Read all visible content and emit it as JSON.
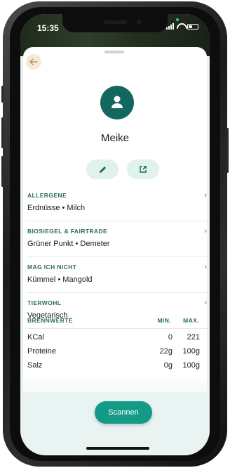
{
  "status_bar": {
    "time": "15:35"
  },
  "profile": {
    "name": "Meike"
  },
  "sections": [
    {
      "title": "ALLERGENE",
      "value": "Erdnüsse • Milch"
    },
    {
      "title": "BIOSIEGEL & FAIRTRADE",
      "value": "Grüner Punkt • Demeter"
    },
    {
      "title": "MAG ICH NICHT",
      "value": "Kümmel • Mangold"
    },
    {
      "title": "TIERWOHL",
      "value": "Vegetarisch"
    }
  ],
  "nutrition": {
    "title": "BRENNWERTE",
    "min_label": "MIN.",
    "max_label": "MAX.",
    "rows": [
      {
        "label": "KCal",
        "min": "0",
        "max": "221"
      },
      {
        "label": "Proteine",
        "min": "22g",
        "max": "100g"
      },
      {
        "label": "Salz",
        "min": "0g",
        "max": "100g"
      }
    ]
  },
  "scan_button": {
    "label": "Scannen"
  },
  "icons": {
    "back": "arrow-left-icon",
    "avatar": "user-icon",
    "edit": "pencil-icon",
    "share": "share-icon",
    "chevron": "chevron-right-icon"
  },
  "colors": {
    "accent": "#139b87",
    "avatar_bg": "#12685e",
    "section_title": "#2c6c62",
    "back_bg": "#f6ead6"
  }
}
